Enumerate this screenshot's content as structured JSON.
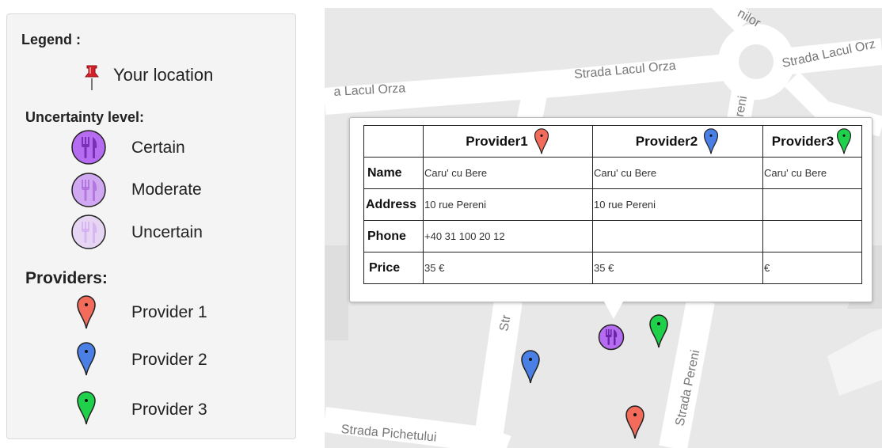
{
  "legend": {
    "title": "Legend :",
    "your_location": "Your location",
    "uncertainty_title": "Uncertainty level:",
    "uncertainty_levels": [
      {
        "label": "Certain",
        "opacity": 1.0
      },
      {
        "label": "Moderate",
        "opacity": 0.55
      },
      {
        "label": "Uncertain",
        "opacity": 0.25
      }
    ],
    "providers_title": "Providers:",
    "providers": [
      {
        "label": "Provider 1",
        "color": "#f26b5b"
      },
      {
        "label": "Provider 2",
        "color": "#4a7fe6"
      },
      {
        "label": "Provider 3",
        "color": "#1fd14a"
      }
    ]
  },
  "map": {
    "streets": {
      "lacul_orza_left": "a Lacul Orza",
      "lacul_orza_mid": "Strada Lacul Orza",
      "lacul_orza_right": "Strada Lacul Orz",
      "pereni_top": "ereni",
      "milor": "nilor",
      "str_fragment": "Str",
      "pereni_bottom": "Strada Pereni",
      "pichetului": "Strada Pichetului"
    }
  },
  "popup": {
    "headers": [
      "",
      "Provider1",
      "Provider2",
      "Provider3"
    ],
    "rows": [
      {
        "label": "Name",
        "values": [
          "Caru' cu Bere",
          "Caru' cu Bere",
          "Caru' cu Bere"
        ]
      },
      {
        "label": "Address",
        "values": [
          "10 rue Pereni",
          "10 rue Pereni",
          ""
        ]
      },
      {
        "label": "Phone",
        "values": [
          "+40 31 100 20 12",
          "",
          ""
        ]
      },
      {
        "label": "Price",
        "values": [
          "35 €",
          "35 €",
          "€"
        ]
      }
    ]
  },
  "colors": {
    "provider1": "#f26b5b",
    "provider2": "#4a7fe6",
    "provider3": "#1fd14a",
    "cluster": "#b56cf0"
  },
  "icons": {
    "location": "pushpin-icon",
    "restaurant": "fork-knife-icon",
    "provider": "map-marker-icon"
  }
}
